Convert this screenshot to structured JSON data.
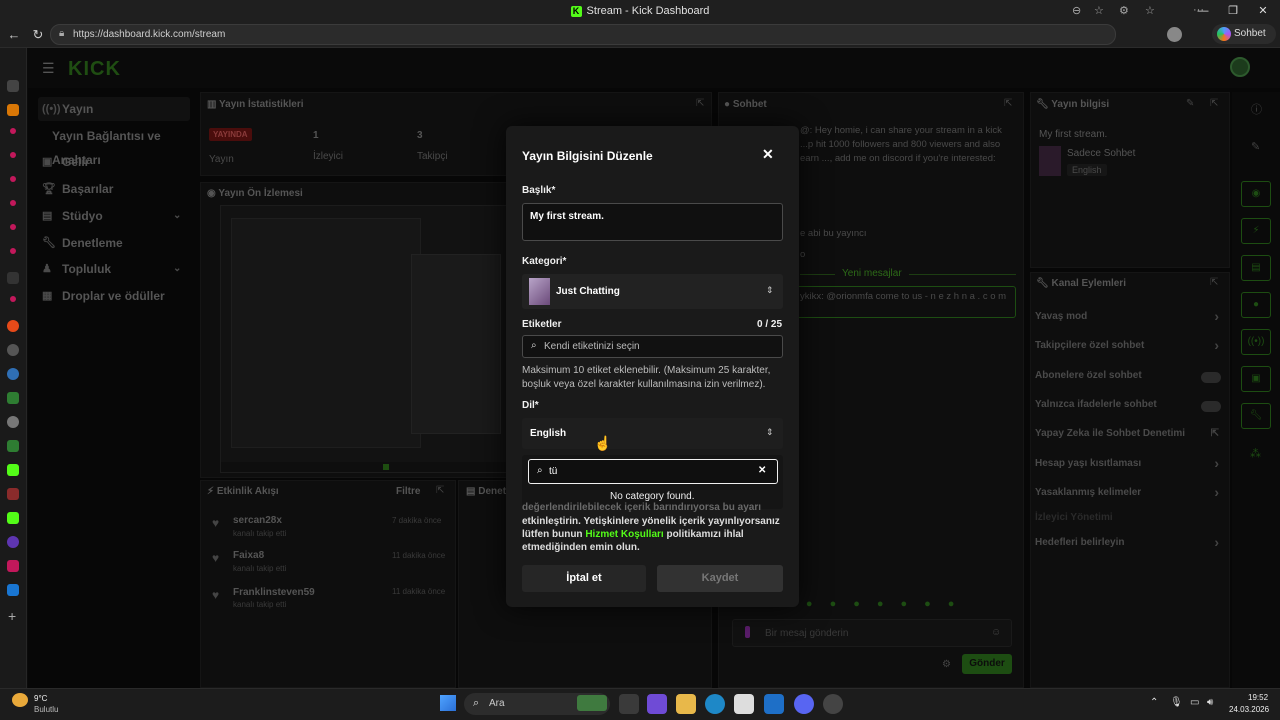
{
  "browser": {
    "window_title": "Stream - Kick Dashboard",
    "url": "https://dashboard.kick.com/stream",
    "copilot_label": "Sohbet et"
  },
  "app": {
    "logo": "KICK",
    "sidebar": [
      {
        "label": "Yayın",
        "icon": "broadcast-icon"
      },
      {
        "label": "Yayın Bağlantısı ve Anahtarı",
        "icon": ""
      },
      {
        "label": "Gelir",
        "icon": "revenue-icon"
      },
      {
        "label": "Başarılar",
        "icon": "trophy-icon"
      },
      {
        "label": "Stüdyo",
        "icon": "studio-icon"
      },
      {
        "label": "Denetleme",
        "icon": "wrench-icon"
      },
      {
        "label": "Topluluk",
        "icon": "community-icon"
      },
      {
        "label": "Droplar ve ödüller",
        "icon": "gift-icon"
      }
    ],
    "stats": {
      "title": "Yayın İstatistikleri",
      "live_badge": "YAYINDA",
      "live_label": "Yayın",
      "viewers_value": "1",
      "viewers_label": "İzleyici",
      "followers_value": "3",
      "followers_label": "Takipçi"
    },
    "preview": {
      "title": "Yayın Ön İzlemesi"
    },
    "activity": {
      "title": "Etkinlik Akışı",
      "filter": "Filtre",
      "items": [
        {
          "name": "sercan28x",
          "action": "kanalı takip etti",
          "time": "7 dakika önce"
        },
        {
          "name": "Faixa8",
          "action": "kanalı takip etti",
          "time": "11 dakika önce"
        },
        {
          "name": "Franklinsteven59",
          "action": "kanalı takip etti",
          "time": "11 dakika önce"
        }
      ]
    },
    "denetleme_title": "Denet",
    "chat": {
      "title": "Sohbet",
      "message": "@: Hey homie, i can share your stream in a kick ...p hit 1000 followers and 800 viewers and also earn ..., add me on discord if you're interested:",
      "line2": "e abi bu yayıncı",
      "line3": "o",
      "new_messages": "Yeni mesajlar",
      "highlight": "ykikx: @orionmfa come to us - n e z h n a . c o m",
      "input_placeholder": "Bir mesaj gönderin",
      "send": "Gönder"
    },
    "stream_info": {
      "title": "Yayın bilgisi",
      "stream_title": "My first stream.",
      "category": "Sadece Sohbet",
      "language": "English"
    },
    "channel_actions": {
      "title": "Kanal Eylemleri",
      "items": [
        {
          "label": "Yavaş mod",
          "type": "chevron"
        },
        {
          "label": "Takipçilere özel sohbet",
          "type": "chevron"
        },
        {
          "label": "Abonelere özel sohbet",
          "type": "toggle"
        },
        {
          "label": "Yalnızca ifadelerle sohbet",
          "type": "toggle"
        },
        {
          "label": "Yapay Zeka ile Sohbet Denetimi",
          "type": "external"
        },
        {
          "label": "Hesap yaşı kısıtlaması",
          "type": "chevron"
        },
        {
          "label": "Yasaklanmış kelimeler",
          "type": "chevron"
        },
        {
          "label": "İzleyici Yönetimi",
          "type": "none"
        },
        {
          "label": "Hedefleri belirleyin",
          "type": "chevron"
        }
      ]
    }
  },
  "modal": {
    "title": "Yayın Bilgisini Düzenle",
    "title_label": "Başlık*",
    "title_value": "My first stream.",
    "category_label": "Kategori*",
    "category_value": "Just Chatting",
    "tags_label": "Etiketler",
    "tags_count": "0 / 25",
    "tags_placeholder": "Kendi etiketinizi seçin",
    "tags_help": "Maksimum 10 etiket eklenebilir. (Maksimum 25 karakter, boşluk veya özel karakter kullanılmasına izin verilmez).",
    "language_label": "Dil*",
    "language_value": "English",
    "search_value": "tü",
    "no_result": "No category found.",
    "notice_line1": "değerlendirilebilecek içerik barındırıyorsa bu ayarı",
    "notice_line2": "etkinleştirin. Yetişkinlere yönelik içerik yayınlıyorsanız",
    "notice_line3_pre": "lütfen bunun",
    "notice_link": "Hizmet Koşulları",
    "notice_line3_post": "politikamızı ihlal",
    "notice_line4": "etmediğinden emin olun.",
    "cancel": "İptal et",
    "save": "Kaydet"
  },
  "taskbar": {
    "weather_temp": "9°C",
    "weather_desc": "Bulutlu",
    "search": "Ara",
    "time": "19:52",
    "date": "24.03.2026"
  },
  "colors": {
    "accent": "#53fc18",
    "live": "#e91916"
  }
}
